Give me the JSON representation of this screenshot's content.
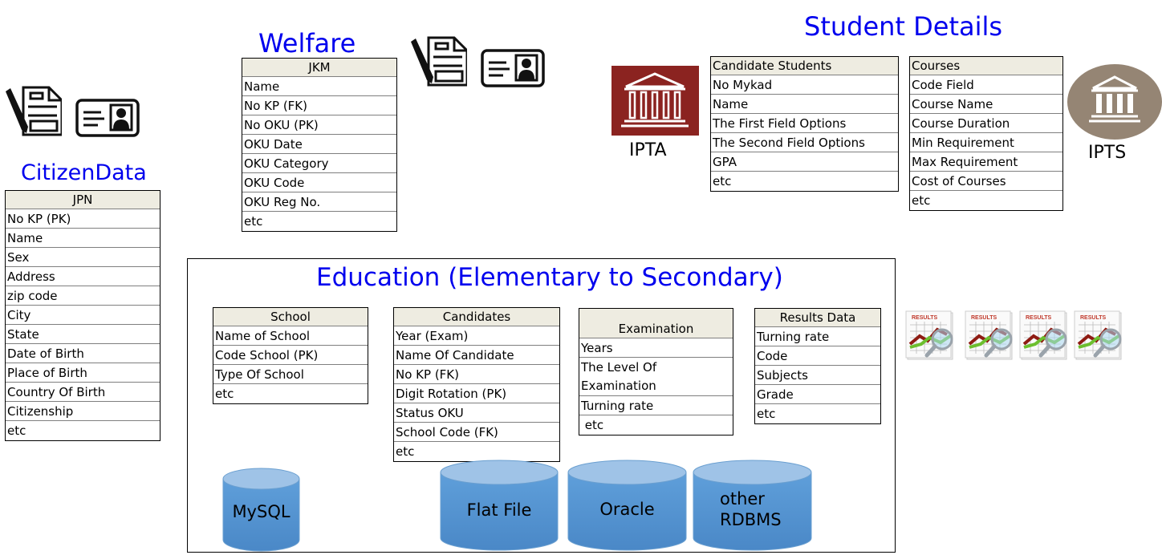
{
  "sections": {
    "citizen": {
      "title": "CitizenData",
      "table": {
        "header": "JPN",
        "rows": [
          "No KP (PK)",
          "Name",
          "Sex",
          "Address",
          "zip code",
          "City",
          "State",
          "Date of Birth",
          "Place of Birth",
          "Country Of Birth",
          "Citizenship",
          "etc"
        ]
      },
      "icons": [
        "form-pen-icon",
        "id-card-icon"
      ]
    },
    "welfare": {
      "title": "Welfare",
      "table": {
        "header": "JKM",
        "rows": [
          "Name",
          "No KP (FK)",
          "No OKU (PK)",
          "OKU Date",
          "OKU Category",
          "OKU Code",
          "OKU Reg No.",
          "etc"
        ]
      },
      "icons": [
        "form-pen-icon",
        "id-card-icon"
      ]
    },
    "student": {
      "title": "Student Details",
      "ipta_label": "IPTA",
      "ipts_label": "IPTS",
      "candidate_students": {
        "header": "Candidate Students",
        "rows": [
          "No Mykad",
          "Name",
          "The First Field Options",
          "The Second Field Options",
          "GPA",
          "etc"
        ]
      },
      "courses": {
        "header": "Courses",
        "rows": [
          "Code Field",
          "Course Name",
          "Course Duration",
          "Min Requirement",
          "Max Requirement",
          "Cost of Courses",
          "etc"
        ]
      }
    },
    "education": {
      "title": "Education (Elementary to Secondary)",
      "school": {
        "header": "School",
        "rows": [
          "Name of School",
          "Code School (PK)",
          "Type Of School",
          "etc"
        ]
      },
      "candidates": {
        "header": "Candidates",
        "rows": [
          "Year (Exam)",
          "Name Of Candidate",
          "No KP (FK)",
          "Digit Rotation (PK)",
          "Status OKU",
          "School Code (FK)",
          "etc"
        ]
      },
      "examination": {
        "header": "Examination",
        "rows": [
          "Years",
          "The Level Of Examination",
          "Turning rate",
          " etc"
        ]
      },
      "results_data": {
        "header": "Results Data",
        "rows": [
          "Turning rate",
          "Code",
          "Subjects",
          "Grade",
          "etc"
        ]
      },
      "databases": [
        "MySQL",
        "Flat File",
        "Oracle",
        "other RDBMS"
      ]
    },
    "results_icons": {
      "label": "RESULTS",
      "count": 4
    }
  },
  "colors": {
    "title_blue": "#0000ee",
    "header_bg": "#eeece1",
    "ipta_red": "#8b2320",
    "ipts_taupe": "#958574",
    "cylinder_blue": "#5b9bd5"
  }
}
